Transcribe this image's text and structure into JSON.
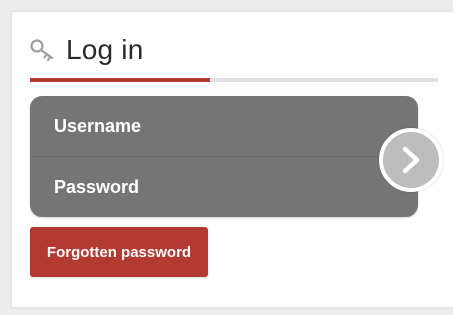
{
  "login": {
    "title": "Log in",
    "title_icon": "key-icon",
    "tab_progress_fraction": 0.44,
    "username_placeholder": "Username",
    "password_placeholder": "Password",
    "submit_icon": "chevron-right-icon",
    "forgot_label": "Forgotten password"
  },
  "colors": {
    "accent": "#b33a31",
    "field_bg": "#757575",
    "submit_bg": "#bdbdbd"
  }
}
